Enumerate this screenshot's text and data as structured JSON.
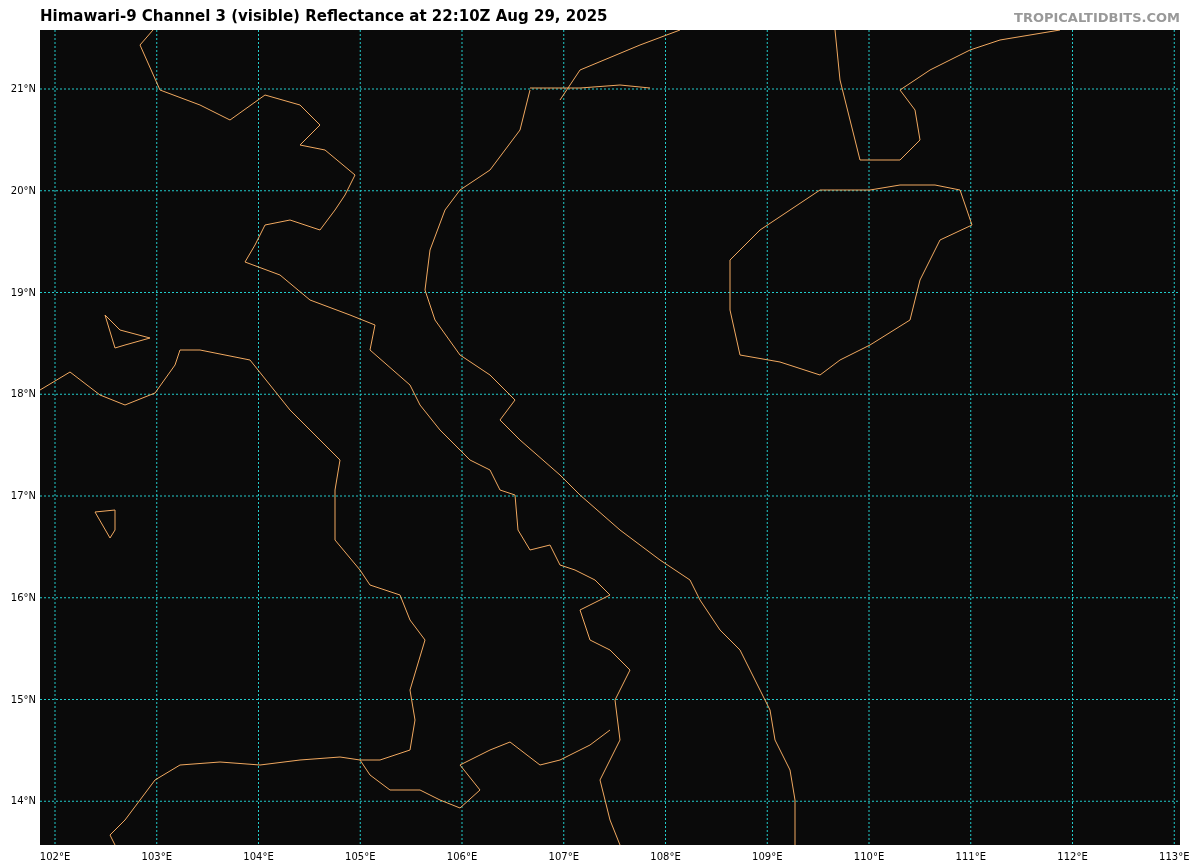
{
  "title": "Himawari-9 Channel 3 (visible) Reflectance at 22:10Z Aug 29, 2025",
  "credit": "TROPICALTIDBITS.COM",
  "lat_labels": [
    "21°N",
    "20°N",
    "19°N",
    "18°N",
    "17°N",
    "16°N",
    "15°N",
    "14°N"
  ],
  "lon_labels": [
    "102°E",
    "103°E",
    "104°E",
    "105°E",
    "106°E",
    "107°E",
    "108°E",
    "109°E",
    "110°E",
    "111°E",
    "112°E",
    "113°E"
  ]
}
